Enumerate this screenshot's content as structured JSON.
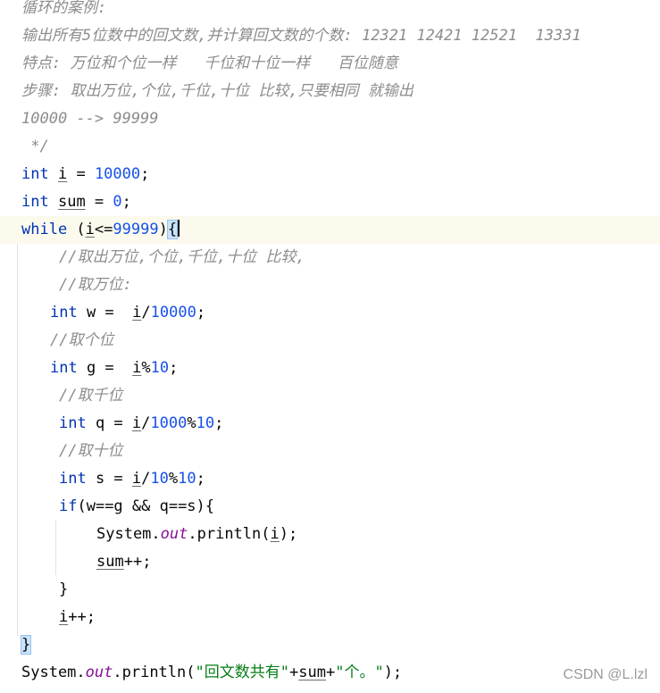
{
  "editor": {
    "lines": [
      {
        "indent": 24,
        "segs": [
          {
            "c": "cmt",
            "t": "循环的案例:"
          }
        ]
      },
      {
        "indent": 24,
        "segs": [
          {
            "c": "cmt",
            "t": "输出所有5位数中的回文数,并计算回文数的个数: 12321 12421 12521  13331"
          }
        ]
      },
      {
        "indent": 24,
        "segs": [
          {
            "c": "cmt",
            "t": "特点: 万位和个位一样   千位和十位一样   百位随意"
          }
        ]
      },
      {
        "indent": 24,
        "segs": [
          {
            "c": "cmt",
            "t": "步骤: 取出万位,个位,千位,十位 比较,只要相同 就输出"
          }
        ]
      },
      {
        "indent": 24,
        "segs": [
          {
            "c": "cmt",
            "t": "10000 --> 99999"
          }
        ]
      },
      {
        "indent": 24,
        "segs": [
          {
            "c": "cmt",
            "t": " */"
          }
        ]
      },
      {
        "indent": 24,
        "segs": [
          {
            "c": "kw",
            "t": "int"
          },
          {
            "c": "",
            "t": " "
          },
          {
            "c": "ul",
            "t": "i"
          },
          {
            "c": "",
            "t": " = "
          },
          {
            "c": "num",
            "t": "10000"
          },
          {
            "c": "",
            "t": ";"
          }
        ]
      },
      {
        "indent": 24,
        "segs": [
          {
            "c": "kw",
            "t": "int"
          },
          {
            "c": "",
            "t": " "
          },
          {
            "c": "ul",
            "t": "sum"
          },
          {
            "c": "",
            "t": " = "
          },
          {
            "c": "num",
            "t": "0"
          },
          {
            "c": "",
            "t": ";"
          }
        ]
      },
      {
        "indent": 24,
        "current": true,
        "segs": [
          {
            "c": "kw",
            "t": "while"
          },
          {
            "c": "",
            "t": " ("
          },
          {
            "c": "ul",
            "t": "i"
          },
          {
            "c": "",
            "t": "<="
          },
          {
            "c": "num",
            "t": "99999"
          },
          {
            "c": "",
            "t": ")"
          },
          {
            "c": "brace-match",
            "t": "{"
          },
          {
            "c": "caret",
            "t": ""
          }
        ]
      },
      {
        "indent": 66,
        "segs": [
          {
            "c": "cmt",
            "t": "//取出万位,个位,千位,十位 比较,"
          }
        ]
      },
      {
        "indent": 66,
        "segs": [
          {
            "c": "cmt",
            "t": "//取万位:"
          }
        ]
      },
      {
        "indent": 56,
        "segs": [
          {
            "c": "kw",
            "t": "int"
          },
          {
            "c": "",
            "t": " w =  "
          },
          {
            "c": "ul",
            "t": "i"
          },
          {
            "c": "",
            "t": "/"
          },
          {
            "c": "num",
            "t": "10000"
          },
          {
            "c": "",
            "t": ";"
          }
        ]
      },
      {
        "indent": 56,
        "segs": [
          {
            "c": "cmt",
            "t": "//取个位"
          }
        ]
      },
      {
        "indent": 56,
        "segs": [
          {
            "c": "kw",
            "t": "int"
          },
          {
            "c": "",
            "t": " g =  "
          },
          {
            "c": "ul",
            "t": "i"
          },
          {
            "c": "",
            "t": "%"
          },
          {
            "c": "num",
            "t": "10"
          },
          {
            "c": "",
            "t": ";"
          }
        ]
      },
      {
        "indent": 66,
        "segs": [
          {
            "c": "cmt",
            "t": "//取千位"
          }
        ]
      },
      {
        "indent": 66,
        "segs": [
          {
            "c": "kw",
            "t": "int"
          },
          {
            "c": "",
            "t": " q = "
          },
          {
            "c": "ul",
            "t": "i"
          },
          {
            "c": "",
            "t": "/"
          },
          {
            "c": "num",
            "t": "1000"
          },
          {
            "c": "",
            "t": "%"
          },
          {
            "c": "num",
            "t": "10"
          },
          {
            "c": "",
            "t": ";"
          }
        ]
      },
      {
        "indent": 66,
        "segs": [
          {
            "c": "cmt",
            "t": "//取十位"
          }
        ]
      },
      {
        "indent": 66,
        "segs": [
          {
            "c": "kw",
            "t": "int"
          },
          {
            "c": "",
            "t": " s = "
          },
          {
            "c": "ul",
            "t": "i"
          },
          {
            "c": "",
            "t": "/"
          },
          {
            "c": "num",
            "t": "10"
          },
          {
            "c": "",
            "t": "%"
          },
          {
            "c": "num",
            "t": "10"
          },
          {
            "c": "",
            "t": ";"
          }
        ]
      },
      {
        "indent": 66,
        "segs": [
          {
            "c": "kw",
            "t": "if"
          },
          {
            "c": "",
            "t": "(w==g && q==s){"
          }
        ]
      },
      {
        "indent": 108,
        "segs": [
          {
            "c": "",
            "t": "System."
          },
          {
            "c": "fld",
            "t": "out"
          },
          {
            "c": "",
            "t": ".println("
          },
          {
            "c": "ul",
            "t": "i"
          },
          {
            "c": "",
            "t": ");"
          }
        ]
      },
      {
        "indent": 108,
        "segs": [
          {
            "c": "ul",
            "t": "sum"
          },
          {
            "c": "",
            "t": "++;"
          }
        ]
      },
      {
        "indent": 66,
        "segs": [
          {
            "c": "",
            "t": "}"
          }
        ]
      },
      {
        "indent": 66,
        "segs": [
          {
            "c": "ul",
            "t": "i"
          },
          {
            "c": "",
            "t": "++;"
          }
        ]
      },
      {
        "indent": 24,
        "segs": [
          {
            "c": "brace-match",
            "t": "}"
          }
        ]
      },
      {
        "indent": 24,
        "segs": [
          {
            "c": "",
            "t": "System."
          },
          {
            "c": "fld",
            "t": "out"
          },
          {
            "c": "",
            "t": ".println("
          },
          {
            "c": "str",
            "t": "\"回文数共有\""
          },
          {
            "c": "",
            "t": "+"
          },
          {
            "c": "ul",
            "t": "sum"
          },
          {
            "c": "",
            "t": "+"
          },
          {
            "c": "str",
            "t": "\"个。\""
          },
          {
            "c": "",
            "t": ");"
          }
        ]
      }
    ]
  },
  "watermark": "CSDN @L.lzl"
}
